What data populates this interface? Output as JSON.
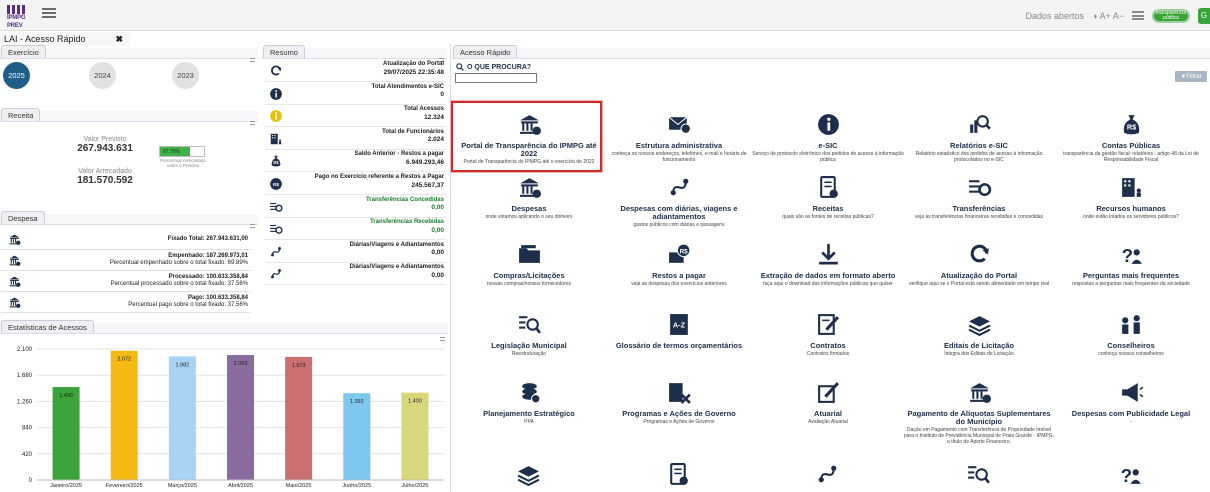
{
  "header": {
    "logo_text": "IPMPG PREV",
    "dados_abertos": "Dados abertos",
    "acessib": "◑ A+ A−",
    "badge": "transparência pública",
    "badge2": "G"
  },
  "tab": {
    "label": "LAI - Acesso Rápido",
    "close": "✖"
  },
  "exercicio": {
    "title": "Exercício",
    "years": [
      "2025",
      "2024",
      "2023"
    ]
  },
  "receita": {
    "title": "Receita",
    "previsto_label": "Valor Previsto",
    "previsto": "267.943.631",
    "arrecadado_label": "Valor Arrecadado",
    "arrecadado": "181.570.592",
    "progress_pct": 67.76,
    "progress_text": "67.76%",
    "progress_caption": "Percentual Arrecadado sobre o Previsto"
  },
  "despesa": {
    "title": "Despesa",
    "rows": [
      {
        "l1": "Fixado Total: 267.943.631,00",
        "l2": ""
      },
      {
        "l1": "Empenhado: 187.269.973,01",
        "l2": "Percentual empenhado sobre o total fixado: 69.89%"
      },
      {
        "l1": "Processado: 100.633.358,84",
        "l2": "Percentual processado sobre o total fixado: 37.56%"
      },
      {
        "l1": "Pago: 100.633.358,84",
        "l2": "Percentual pago sobre o total fixado: 37.56%"
      }
    ]
  },
  "resumo": {
    "title": "Resumo",
    "rows": [
      {
        "label": "Atualização do Portal",
        "value": "29/07/2025 22:35:48",
        "icon": "refresh-icon"
      },
      {
        "label": "Total Atendimentos e-SIC",
        "value": "0",
        "icon": "info-icon"
      },
      {
        "label": "Total Acessos",
        "value": "12.324",
        "icon": "info-yellow-icon"
      },
      {
        "label": "Total de Funcionários",
        "value": "2.024",
        "icon": "building-icon"
      },
      {
        "label": "Saldo Anterior - Restos a pagar",
        "value": "6.949.293,46",
        "icon": "money-bag-icon"
      },
      {
        "label": "Pago no Exercício referente a Restos a Pagar",
        "value": "245.567,37",
        "icon": "rs-bag-icon"
      },
      {
        "label": "Transferências Concedidas",
        "value": "0,00",
        "icon": "transfer-icon",
        "green": true
      },
      {
        "label": "Transferências Recebidas",
        "value": "0,00",
        "icon": "transfer-icon",
        "green": true
      },
      {
        "label": "Diárias/Viagens e Adiantamentos",
        "value": "0,00",
        "icon": "route-icon"
      },
      {
        "label": "Diárias/Viagens e Adiantamentos",
        "value": "0,00",
        "icon": "route-icon"
      }
    ]
  },
  "estatisticas": {
    "title": "Estatísticas de Acessos"
  },
  "chart_data": {
    "type": "bar",
    "categories": [
      "Janeiro/2025",
      "Fevereiro/2025",
      "Março/2025",
      "Abril/2025",
      "Maio/2025",
      "Junho/2025",
      "Julho/2025"
    ],
    "values": [
      1490,
      2072,
      1982,
      2003,
      1973,
      1392,
      1400
    ],
    "labels": [
      "1.490",
      "2.072",
      "1.982",
      "2.003",
      "1.973",
      "1.392",
      "1.400"
    ],
    "colors": [
      "#3aa33a",
      "#f5b914",
      "#a9d3f5",
      "#8a6b9e",
      "#cc6f73",
      "#7ec7ee",
      "#d9d77b"
    ],
    "yticks": [
      "0",
      "420",
      "840",
      "1.260",
      "1.680",
      "2.100"
    ],
    "ytick_values": [
      0,
      420,
      840,
      1260,
      1680,
      2100
    ],
    "ylim": [
      0,
      2100
    ]
  },
  "acesso": {
    "title": "Acesso Rápido",
    "search_label": "O QUE PROCURA?",
    "filter_label": "▼Filtrar",
    "cards": [
      {
        "title": "Portal de Transparência do IPMPG até 2022",
        "sub": "Portal de Transparência do IPMPG até o exercício de 2022",
        "icon": "bank-icon"
      },
      {
        "title": "Estrutura administrativa",
        "sub": "conheça os nossos endereços, telefones, e-mail e horário de funcionamento",
        "icon": "mail-icon"
      },
      {
        "title": "e-SIC",
        "sub": "Serviço de protocolo eletrônico dos pedidos de acesso à informação pública",
        "icon": "info-icon"
      },
      {
        "title": "Relatórios e-SIC",
        "sub": "Relatório estatístico dos pedidos de acesso à informação protocolados no e-SIC",
        "icon": "report-icon"
      },
      {
        "title": "Contas Públicas",
        "sub": "transparência da gestão fiscal: relatórios - artigo 48 da Lei de Responsabilidade Fiscal",
        "icon": "money-bag-icon"
      },
      {
        "title": "Despesas",
        "sub": "onde estamos aplicando o seu dinheiro",
        "icon": "bank-icon"
      },
      {
        "title": "Despesas com diárias, viagens e adiantamentos",
        "sub": "gastos públicos com diárias e passagens",
        "icon": "route-icon"
      },
      {
        "title": "Receitas",
        "sub": "quais são as fontes de receitas públicas?",
        "icon": "doc-icon"
      },
      {
        "title": "Transferências",
        "sub": "veja as transferências financeiras recebidas e concedidas",
        "icon": "transfer-icon"
      },
      {
        "title": "Recursos humanos",
        "sub": "onde estão lotados os servidores públicos?",
        "icon": "building-icon"
      },
      {
        "title": "Compras/Licitações",
        "sub": "nossas compras/nossos fornecedores",
        "icon": "folder-icon"
      },
      {
        "title": "Restos a pagar",
        "sub": "veja as despesas dos exercícios anteriores",
        "icon": "money-icon"
      },
      {
        "title": "Extração de dados em formato aberto",
        "sub": "faça aqui o download das informações públicas que quiser",
        "icon": "download-icon"
      },
      {
        "title": "Atualização do Portal",
        "sub": "verifique aqui se o Portal está sendo alimentado em tempo real",
        "icon": "refresh-icon"
      },
      {
        "title": "Perguntas mais frequentes",
        "sub": "respostas a perguntas mais frequentes da sociedade",
        "icon": "question-icon"
      },
      {
        "title": "Legislação Municipal",
        "sub": "Reestruturação",
        "icon": "search-list-icon"
      },
      {
        "title": "Glossário de termos orçamentários",
        "sub": "",
        "icon": "az-icon"
      },
      {
        "title": "Contratos",
        "sub": "Contratos firmados",
        "icon": "edit-icon"
      },
      {
        "title": "Editais de Licitação",
        "sub": "Íntegra dos Editais de Licitação",
        "icon": "stack-icon"
      },
      {
        "title": "Conselheiros",
        "sub": "conheça nossos conselheiros",
        "icon": "people-icon"
      },
      {
        "title": "Planejamento Estratégico",
        "sub": "PPA",
        "icon": "coins-icon"
      },
      {
        "title": "Programas e Ações de Governo",
        "sub": "Programas e Ações de Governo",
        "icon": "tools-icon"
      },
      {
        "title": "Atuarial",
        "sub": "Avaliação Atuarial",
        "icon": "calc-icon"
      },
      {
        "title": "Pagamento de Alíquotas Suplementares do Município",
        "sub": "Dação em Pagamento com Transferência de Propriedade Imóvel para o Instituto de Previdência Municipal de Praia Grande - IPMPG, a título de Aporte Financeiro.",
        "icon": "bank-icon"
      },
      {
        "title": "Despesas com Publicidade Legal",
        "sub": "-",
        "icon": "megaphone-icon"
      }
    ]
  }
}
